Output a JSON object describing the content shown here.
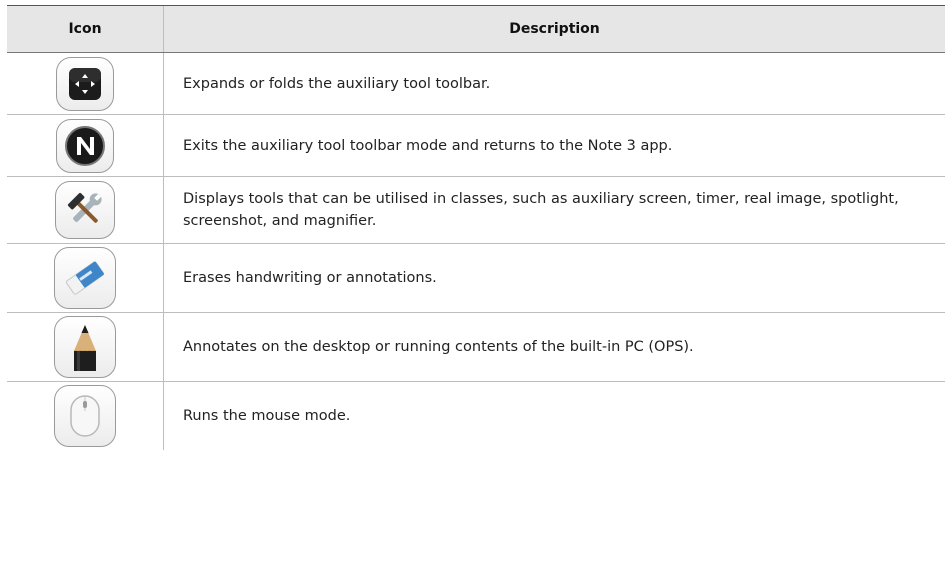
{
  "table": {
    "headers": {
      "icon": "Icon",
      "description": "Description"
    },
    "rows": [
      {
        "icon": "auxiliary-toolbar-toggle-icon",
        "description": "Expands or folds the auxiliary tool toolbar."
      },
      {
        "icon": "note-app-n-icon",
        "description": "Exits the auxiliary tool toolbar mode and returns to the Note 3 app."
      },
      {
        "icon": "tools-wrench-hammer-icon",
        "description": "Displays tools that can be utilised in classes, such as auxiliary screen, timer, real image, spotlight, screenshot, and magnifier."
      },
      {
        "icon": "eraser-icon",
        "description": "Erases handwriting or annotations."
      },
      {
        "icon": "pencil-icon",
        "description": "Annotates on the desktop or running contents of the built-in PC (OPS)."
      },
      {
        "icon": "mouse-icon",
        "description": "Runs the mouse mode."
      }
    ]
  },
  "colors": {
    "header_bg": "#e6e6e6",
    "grid_line": "#bdbdbd",
    "text": "#222222"
  }
}
